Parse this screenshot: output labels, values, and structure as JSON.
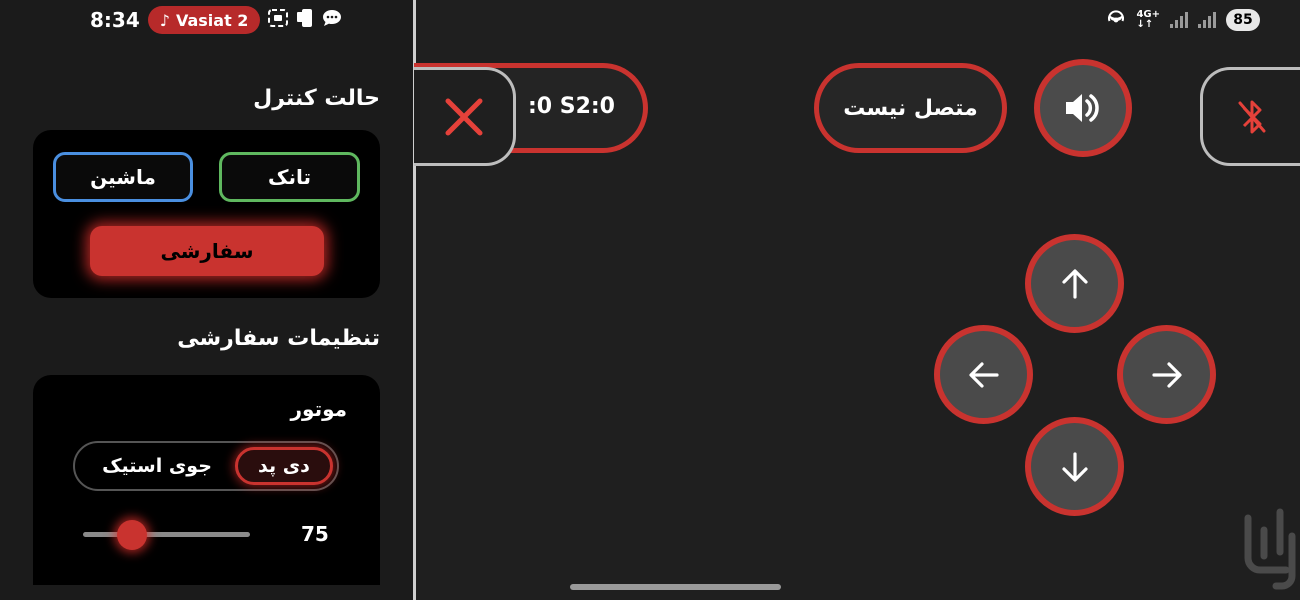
{
  "status_bar": {
    "time": "8:34",
    "now_playing": "Vasiat 2",
    "battery": "85",
    "network": "4G+"
  },
  "sidebar": {
    "control_mode_title": "حالت کنترل",
    "modes": {
      "car": "ماشین",
      "tank": "تانک",
      "custom": "سفارشی"
    },
    "custom_settings_title": "تنظیمات سفارشی",
    "motor_label": "موتور",
    "motor_input": {
      "joystick": "جوی استیک",
      "dpad": "دی پد",
      "selected": "dpad"
    },
    "speed": {
      "value": 75,
      "min": 0,
      "max": 255,
      "display": "75"
    }
  },
  "main": {
    "servo_readout": ":0   S2:0",
    "connection_status": "متصل نیست",
    "icons": {
      "close": "close-x-icon",
      "sound": "speaker-icon",
      "bluetooth": "bluetooth-disabled-icon",
      "up": "arrow-up-icon",
      "down": "arrow-down-icon",
      "left": "arrow-left-icon",
      "right": "arrow-right-icon"
    }
  },
  "colors": {
    "accent_red": "#c9332f",
    "car_border": "#4a8fe0",
    "tank_border": "#5fb85f",
    "panel_bg": "#1f1f1f",
    "card_bg": "#000000"
  }
}
